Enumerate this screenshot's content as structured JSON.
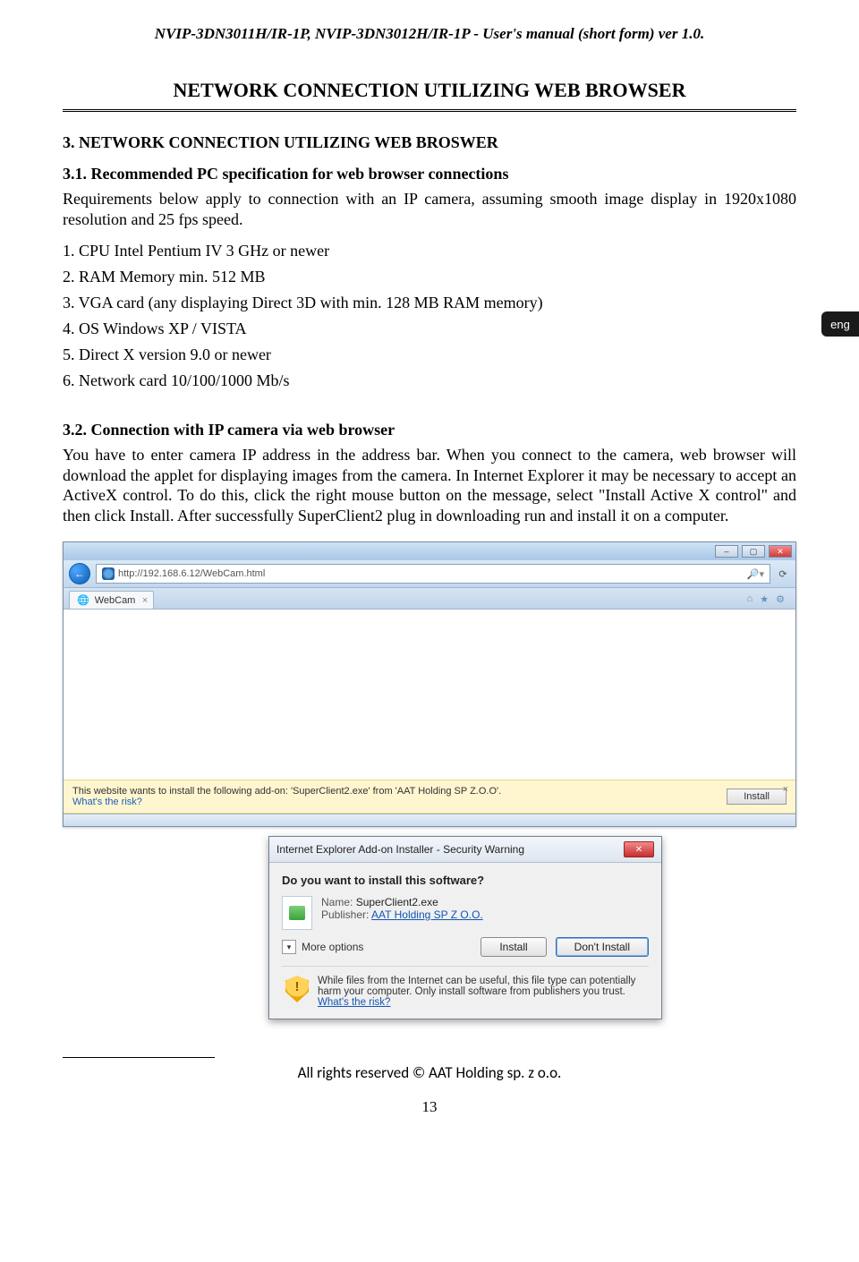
{
  "doc_header": "NVIP-3DN3011H/IR-1P, NVIP-3DN3012H/IR-1P - User's manual (short form) ver 1.0.",
  "section_title": "NETWORK CONNECTION UTILIZING WEB BROWSER",
  "sub1": "3. NETWORK CONNECTION UTILIZING WEB BROSWER",
  "sub2": "3.1. Recommended PC specification for web browser connections",
  "intro": "Requirements below apply to connection with an IP camera, assuming smooth image display in 1920x1080 resolution and 25 fps speed.",
  "reqs": [
    "1. CPU Intel Pentium IV 3 GHz or newer",
    "2. RAM Memory min. 512 MB",
    "3. VGA card (any displaying Direct 3D with min. 128 MB RAM memory)",
    "4. OS Windows XP / VISTA",
    "5. Direct X version 9.0 or newer",
    "6. Network card 10/100/1000 Mb/s"
  ],
  "eng_tab": "eng",
  "sub3": "3.2. Connection with IP camera via web browser",
  "para2": "You have to enter camera IP address in the address bar. When you connect to the camera, web browser will download the applet for displaying images from the camera. In Internet Explorer it may be necessary to accept an ActiveX control. To do this, click the right mouse button on the message, select \"Install Active X control\" and then click Install. After successfully SuperClient2 plug in downloading run and install it on a computer.",
  "browser": {
    "url": "http://192.168.6.12/WebCam.html",
    "tab_label": "WebCam",
    "infobar_text": "This website wants to install the following add-on: 'SuperClient2.exe' from 'AAT Holding SP Z.O.O'.",
    "infobar_risk": "What's the risk?",
    "install": "Install"
  },
  "dialog": {
    "title": "Internet Explorer Add-on Installer - Security Warning",
    "question": "Do you want to install this software?",
    "name_label": "Name:",
    "name_value": "SuperClient2.exe",
    "pub_label": "Publisher:",
    "pub_value": "AAT Holding SP Z O.O.",
    "more": "More options",
    "btn_install": "Install",
    "btn_dont": "Don't Install",
    "warn_text": "While files from the Internet can be useful, this file type can potentially harm your computer. Only install software from publishers you trust.",
    "warn_link": "What's the risk?"
  },
  "footer": "All rights reserved © AAT Holding sp. z o.o.",
  "page_number": "13"
}
